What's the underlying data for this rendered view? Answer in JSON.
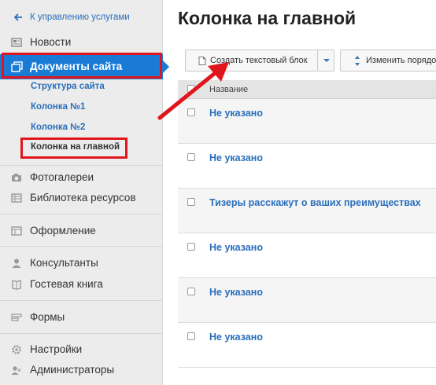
{
  "sidebar": {
    "back_label": "К управлению услугами",
    "items": {
      "news": "Новости",
      "documents": "Документы сайта",
      "photo": "Фотогалереи",
      "library": "Библиотека ресурсов",
      "design": "Оформление",
      "consultants": "Консультанты",
      "guestbook": "Гостевая книга",
      "forms": "Формы",
      "settings": "Настройки",
      "admins": "Администраторы"
    },
    "subitems": {
      "structure": "Структура сайта",
      "col1": "Колонка №1",
      "col2": "Колонка №2",
      "main_col": "Колонка на главной"
    }
  },
  "main": {
    "title": "Колонка на главной",
    "toolbar": {
      "create_label": "Создать текстовый блок",
      "order_label": "Изменить порядок"
    },
    "table": {
      "header": "Название",
      "rows": [
        "Не указано",
        "Не указано",
        "Тизеры расскажут о ваших преимуществах",
        "Не указано",
        "Не указано",
        "Не указано"
      ]
    }
  },
  "colors": {
    "accent": "#1a7bd6",
    "link": "#2a6ebb",
    "highlight": "#e0161c"
  }
}
